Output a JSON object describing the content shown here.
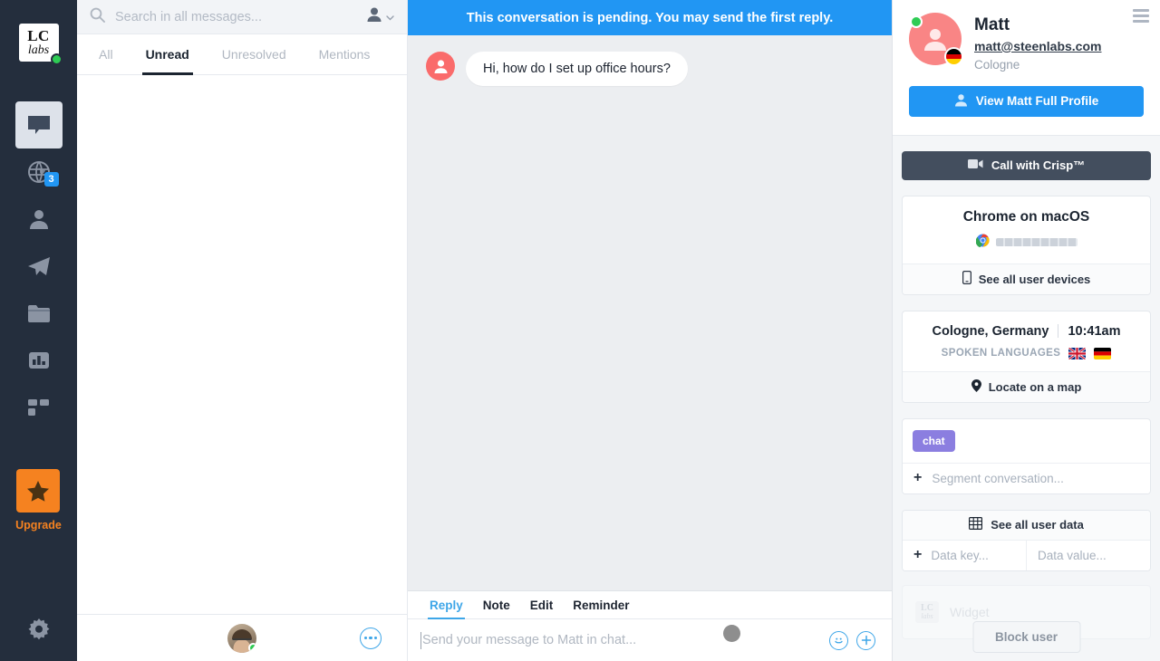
{
  "rail": {
    "logo": {
      "line1": "LC",
      "line2": "labs"
    },
    "items": [
      {
        "name": "inbox",
        "icon": "chat-inbox-icon",
        "badge": ""
      },
      {
        "name": "visitors",
        "icon": "globe-icon",
        "badge": "3"
      },
      {
        "name": "contacts",
        "icon": "person-icon",
        "badge": ""
      },
      {
        "name": "campaigns",
        "icon": "paper-plane-icon",
        "badge": ""
      },
      {
        "name": "helpdesk",
        "icon": "folder-icon",
        "badge": ""
      },
      {
        "name": "analytics",
        "icon": "bar-chart-icon",
        "badge": ""
      },
      {
        "name": "plugins",
        "icon": "blocks-icon",
        "badge": ""
      }
    ],
    "upgrade_label": "Upgrade",
    "settings_icon": "gear-icon"
  },
  "search": {
    "placeholder": "Search in all messages...",
    "value": "",
    "icon": "search-icon",
    "assignee_icon": "person-filter-icon"
  },
  "tabs": [
    {
      "label": "All",
      "active": false
    },
    {
      "label": "Unread",
      "active": true
    },
    {
      "label": "Unresolved",
      "active": false
    },
    {
      "label": "Mentions",
      "active": false
    }
  ],
  "chat": {
    "banner": "This conversation is pending. You may send the first reply.",
    "messages": [
      {
        "author": "Matt",
        "text": "Hi, how do I set up office hours?",
        "side": "left"
      }
    ],
    "composer": {
      "tabs": [
        {
          "label": "Reply",
          "active": true
        },
        {
          "label": "Note",
          "active": false
        },
        {
          "label": "Edit",
          "active": false
        },
        {
          "label": "Reminder",
          "active": false
        }
      ],
      "placeholder": "Send your message to Matt in chat...",
      "value": "",
      "emoji_icon": "smiley-icon",
      "attach_icon": "plus-circle-icon"
    }
  },
  "profile": {
    "name": "Matt",
    "email": "matt@steenlabs.com",
    "city": "Cologne",
    "view_profile_label": "View Matt Full Profile",
    "menu_icon": "hamburger-menu-icon",
    "status_color": "#2ecc54",
    "avatar_color": "#f98585"
  },
  "panel": {
    "call_label": "Call with Crisp™",
    "device": {
      "title": "Chrome on macOS",
      "browser_icon": "chrome-icon",
      "redacted": true,
      "action_label": "See all user devices",
      "action_icon": "phone-icon"
    },
    "location": {
      "place": "Cologne, Germany",
      "time": "10:41am",
      "languages_label": "SPOKEN LANGUAGES",
      "flags": [
        "uk-flag",
        "germany-flag"
      ],
      "action_label": "Locate on a map",
      "action_icon": "map-pin-icon"
    },
    "segments": {
      "chips": [
        "chat"
      ],
      "add_placeholder": "Segment conversation..."
    },
    "user_data": {
      "header_label": "See all user data",
      "header_icon": "table-icon",
      "key_placeholder": "Data key...",
      "value_placeholder": "Data value..."
    },
    "ghost_widget": {
      "logo_line1": "LC",
      "logo_line2": "labs",
      "text": "Widget"
    },
    "block_label": "Block user"
  },
  "footer": {
    "more_icon": "ellipsis-icon",
    "avatar_name": "operator-avatar"
  },
  "colors": {
    "accent_blue": "#2196f3",
    "rail_bg": "#242e3d",
    "upgrade_orange": "#f58220",
    "segment_purple": "#8b7ee0",
    "online_green": "#2ecc54",
    "dark_button": "#434e5e"
  }
}
